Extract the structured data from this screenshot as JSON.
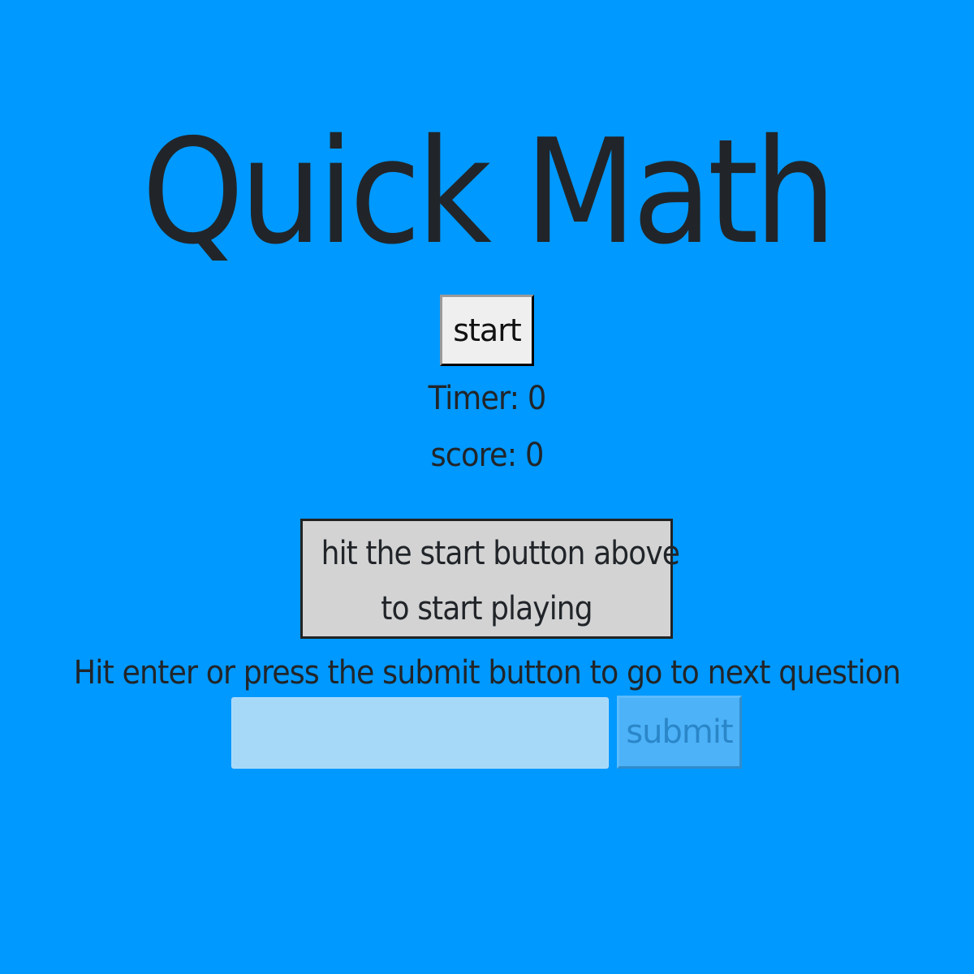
{
  "title": "Quick Math",
  "start_button": {
    "label": "start"
  },
  "timer": {
    "text": "Timer: 0"
  },
  "score": {
    "text": "score: 0"
  },
  "question_box": {
    "line1": "hit the start button above",
    "line2": "to start playing"
  },
  "instructions": "Hit enter or press the submit button to go to next question",
  "answer_input": {
    "value": "",
    "placeholder": ""
  },
  "submit_button": {
    "label": "submit",
    "disabled": true
  },
  "colors": {
    "background": "#0099ff",
    "text": "#212529",
    "question_box_bg": "#d3d3d3",
    "input_bg": "#a6d8f8",
    "submit_bg": "#4db2f7"
  }
}
